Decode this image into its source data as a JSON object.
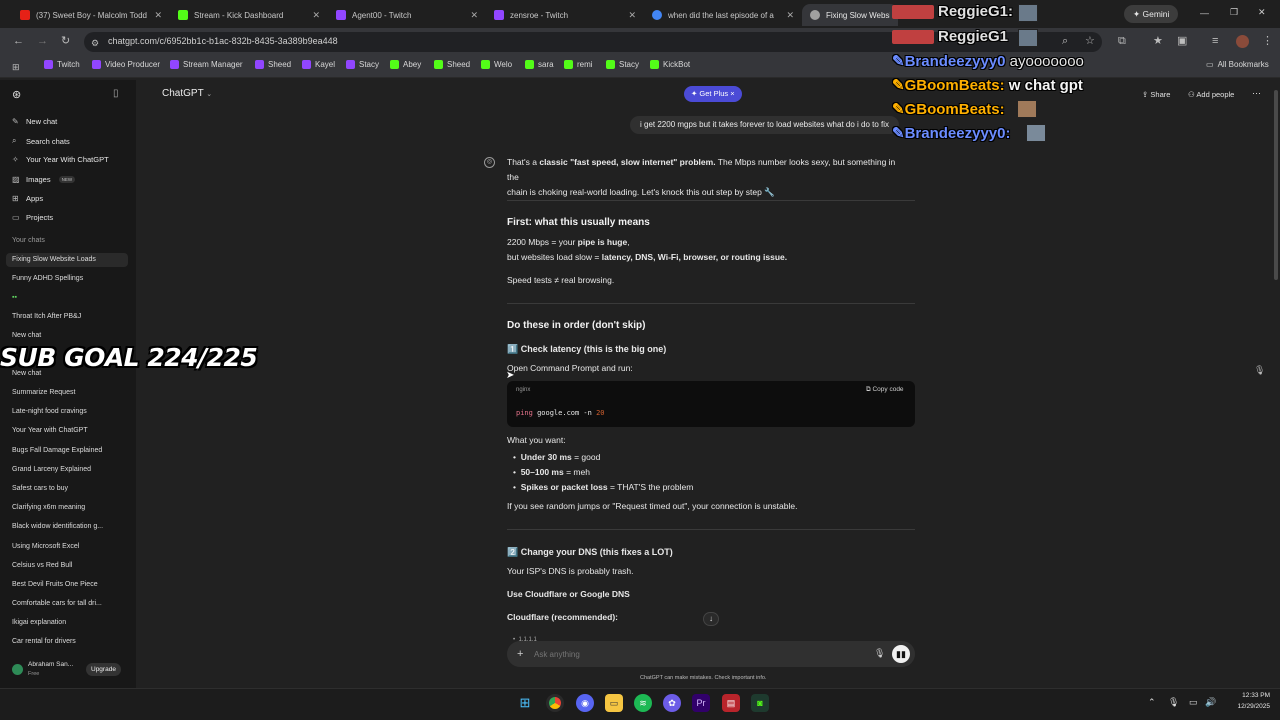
{
  "browser": {
    "tabs": [
      {
        "label": "(37) Sweet Boy - Malcolm Todd",
        "color": "#e62117"
      },
      {
        "label": "Stream - Kick Dashboard",
        "color": "#53fc18"
      },
      {
        "label": "Agent00 - Twitch",
        "color": "#9146ff"
      },
      {
        "label": "zensroe - Twitch",
        "color": "#9146ff"
      },
      {
        "label": "when did the last episode of a",
        "color": "#4285f4"
      },
      {
        "label": "Fixing Slow Website",
        "color": "#a0a0a0"
      }
    ],
    "gemini_label": "Gemini",
    "url": "chatgpt.com/c/6952bb1c-b1ac-832b-8435-3a389b9ea448",
    "bookmarks": [
      {
        "label": "Twitch",
        "color": "#9146ff"
      },
      {
        "label": "Video Producer",
        "color": "#9146ff"
      },
      {
        "label": "Stream Manager",
        "color": "#9146ff"
      },
      {
        "label": "Sheed",
        "color": "#9146ff"
      },
      {
        "label": "Kayel",
        "color": "#9146ff"
      },
      {
        "label": "Stacy",
        "color": "#9146ff"
      },
      {
        "label": "Abey",
        "color": "#53fc18"
      },
      {
        "label": "Sheed",
        "color": "#53fc18"
      },
      {
        "label": "Welo",
        "color": "#53fc18"
      },
      {
        "label": "sara",
        "color": "#53fc18"
      },
      {
        "label": "remi",
        "color": "#53fc18"
      },
      {
        "label": "Stacy",
        "color": "#53fc18"
      },
      {
        "label": "KickBot",
        "color": "#53fc18"
      }
    ],
    "all_bookmarks": "All Bookmarks"
  },
  "sidebar": {
    "nav": [
      {
        "label": "New chat",
        "icon": "edit-icon"
      },
      {
        "label": "Search chats",
        "icon": "search-icon"
      },
      {
        "label": "Your Year With ChatGPT",
        "icon": "sparkle-icon"
      },
      {
        "label": "Images",
        "icon": "image-icon",
        "badge": "NEW"
      },
      {
        "label": "Apps",
        "icon": "apps-icon"
      },
      {
        "label": "Projects",
        "icon": "folder-icon"
      }
    ],
    "section_label": "Your chats",
    "chats": [
      "Fixing Slow Website Loads",
      "Funny ADHD Spellings",
      "",
      "Throat Itch After PB&J",
      "New chat",
      "",
      "New chat",
      "Summarize Request",
      "Late-night food cravings",
      "Your Year with ChatGPT",
      "Bugs Fall Damage Explained",
      "Grand Larceny Explained",
      "Safest cars to buy",
      "Clarifying x6m meaning",
      "Black widow identification g...",
      "Using Microsoft Excel",
      "Celsius vs Red Bull",
      "Best Devil Fruits One Piece",
      "Comfortable cars for tall dri...",
      "Ikigai explanation",
      "Car rental for drivers"
    ],
    "user_name": "Abraham San...",
    "user_plan": "Free",
    "upgrade": "Upgrade"
  },
  "header": {
    "model": "ChatGPT",
    "get_plus": "Get Plus",
    "share": "Share",
    "add_people": "Add people"
  },
  "conversation": {
    "user_message": "i get 2200 mgps but it takes forever to load websites what do i do to fix",
    "intro_1a": "That's a ",
    "intro_1b": "classic \"fast speed, slow internet\" problem.",
    "intro_1c": " The Mbps number looks sexy, but something in the",
    "intro_2": "chain is choking real-world loading. Let's knock this out step by step 🔧",
    "h_first": "First: what this usually means",
    "first_1a": "2200 Mbps = your ",
    "first_1b": "pipe is huge",
    "first_1c": ",",
    "first_2a": "but websites load slow = ",
    "first_2b": "latency, DNS, Wi-Fi, browser, or routing issue.",
    "first_3": "Speed tests ≠ real browsing.",
    "h_order": "Do these in order (don't skip)",
    "step1": "1️⃣ Check latency (this is the big one)",
    "step1_intro": "Open Command Prompt and run:",
    "code_lang": "nginx",
    "copy_code": "Copy code",
    "code_cmd": "ping",
    "code_arg": "google.com -n",
    "code_num": "20",
    "want": "What you want:",
    "bullets": [
      {
        "bold": "Under 30 ms",
        "rest": " = good"
      },
      {
        "bold": "50–100 ms",
        "rest": " = meh"
      },
      {
        "bold": "Spikes or packet loss",
        "rest": " = THAT'S the problem"
      }
    ],
    "unstable": "If you see random jumps or \"Request timed out\", your connection is unstable.",
    "step2": "2️⃣ Change your DNS (this fixes a LOT)",
    "step2_text": "Your ISP's DNS is probably trash.",
    "use_dns": "Use Cloudflare or Google DNS",
    "cloudflare": "Cloudflare (recommended):",
    "partial": "1.1.1.1"
  },
  "composer": {
    "placeholder": "Ask anything",
    "disclaimer": "ChatGPT can make mistakes. Check important info."
  },
  "overlay": {
    "sub_goal": "SUB GOAL 224/225",
    "chat": [
      {
        "user": "ReggieG1:",
        "text": "",
        "color": "#e0e0e0"
      },
      {
        "user": "ReggieG1",
        "text": "",
        "color": "#e0e0e0"
      },
      {
        "user": "Brandeezyyy0",
        "text": "ayooooooo",
        "color": "#6b8cff"
      },
      {
        "user": "GBoomBeats:",
        "text": "w chat gpt",
        "color": "#ffb000"
      },
      {
        "user": "GBoomBeats:",
        "text": "",
        "color": "#ffb000"
      },
      {
        "user": "Brandeezyyy0:",
        "text": "",
        "color": "#6b8cff"
      }
    ]
  },
  "taskbar": {
    "time": "12:33 PM",
    "date": "12/29/2025"
  }
}
